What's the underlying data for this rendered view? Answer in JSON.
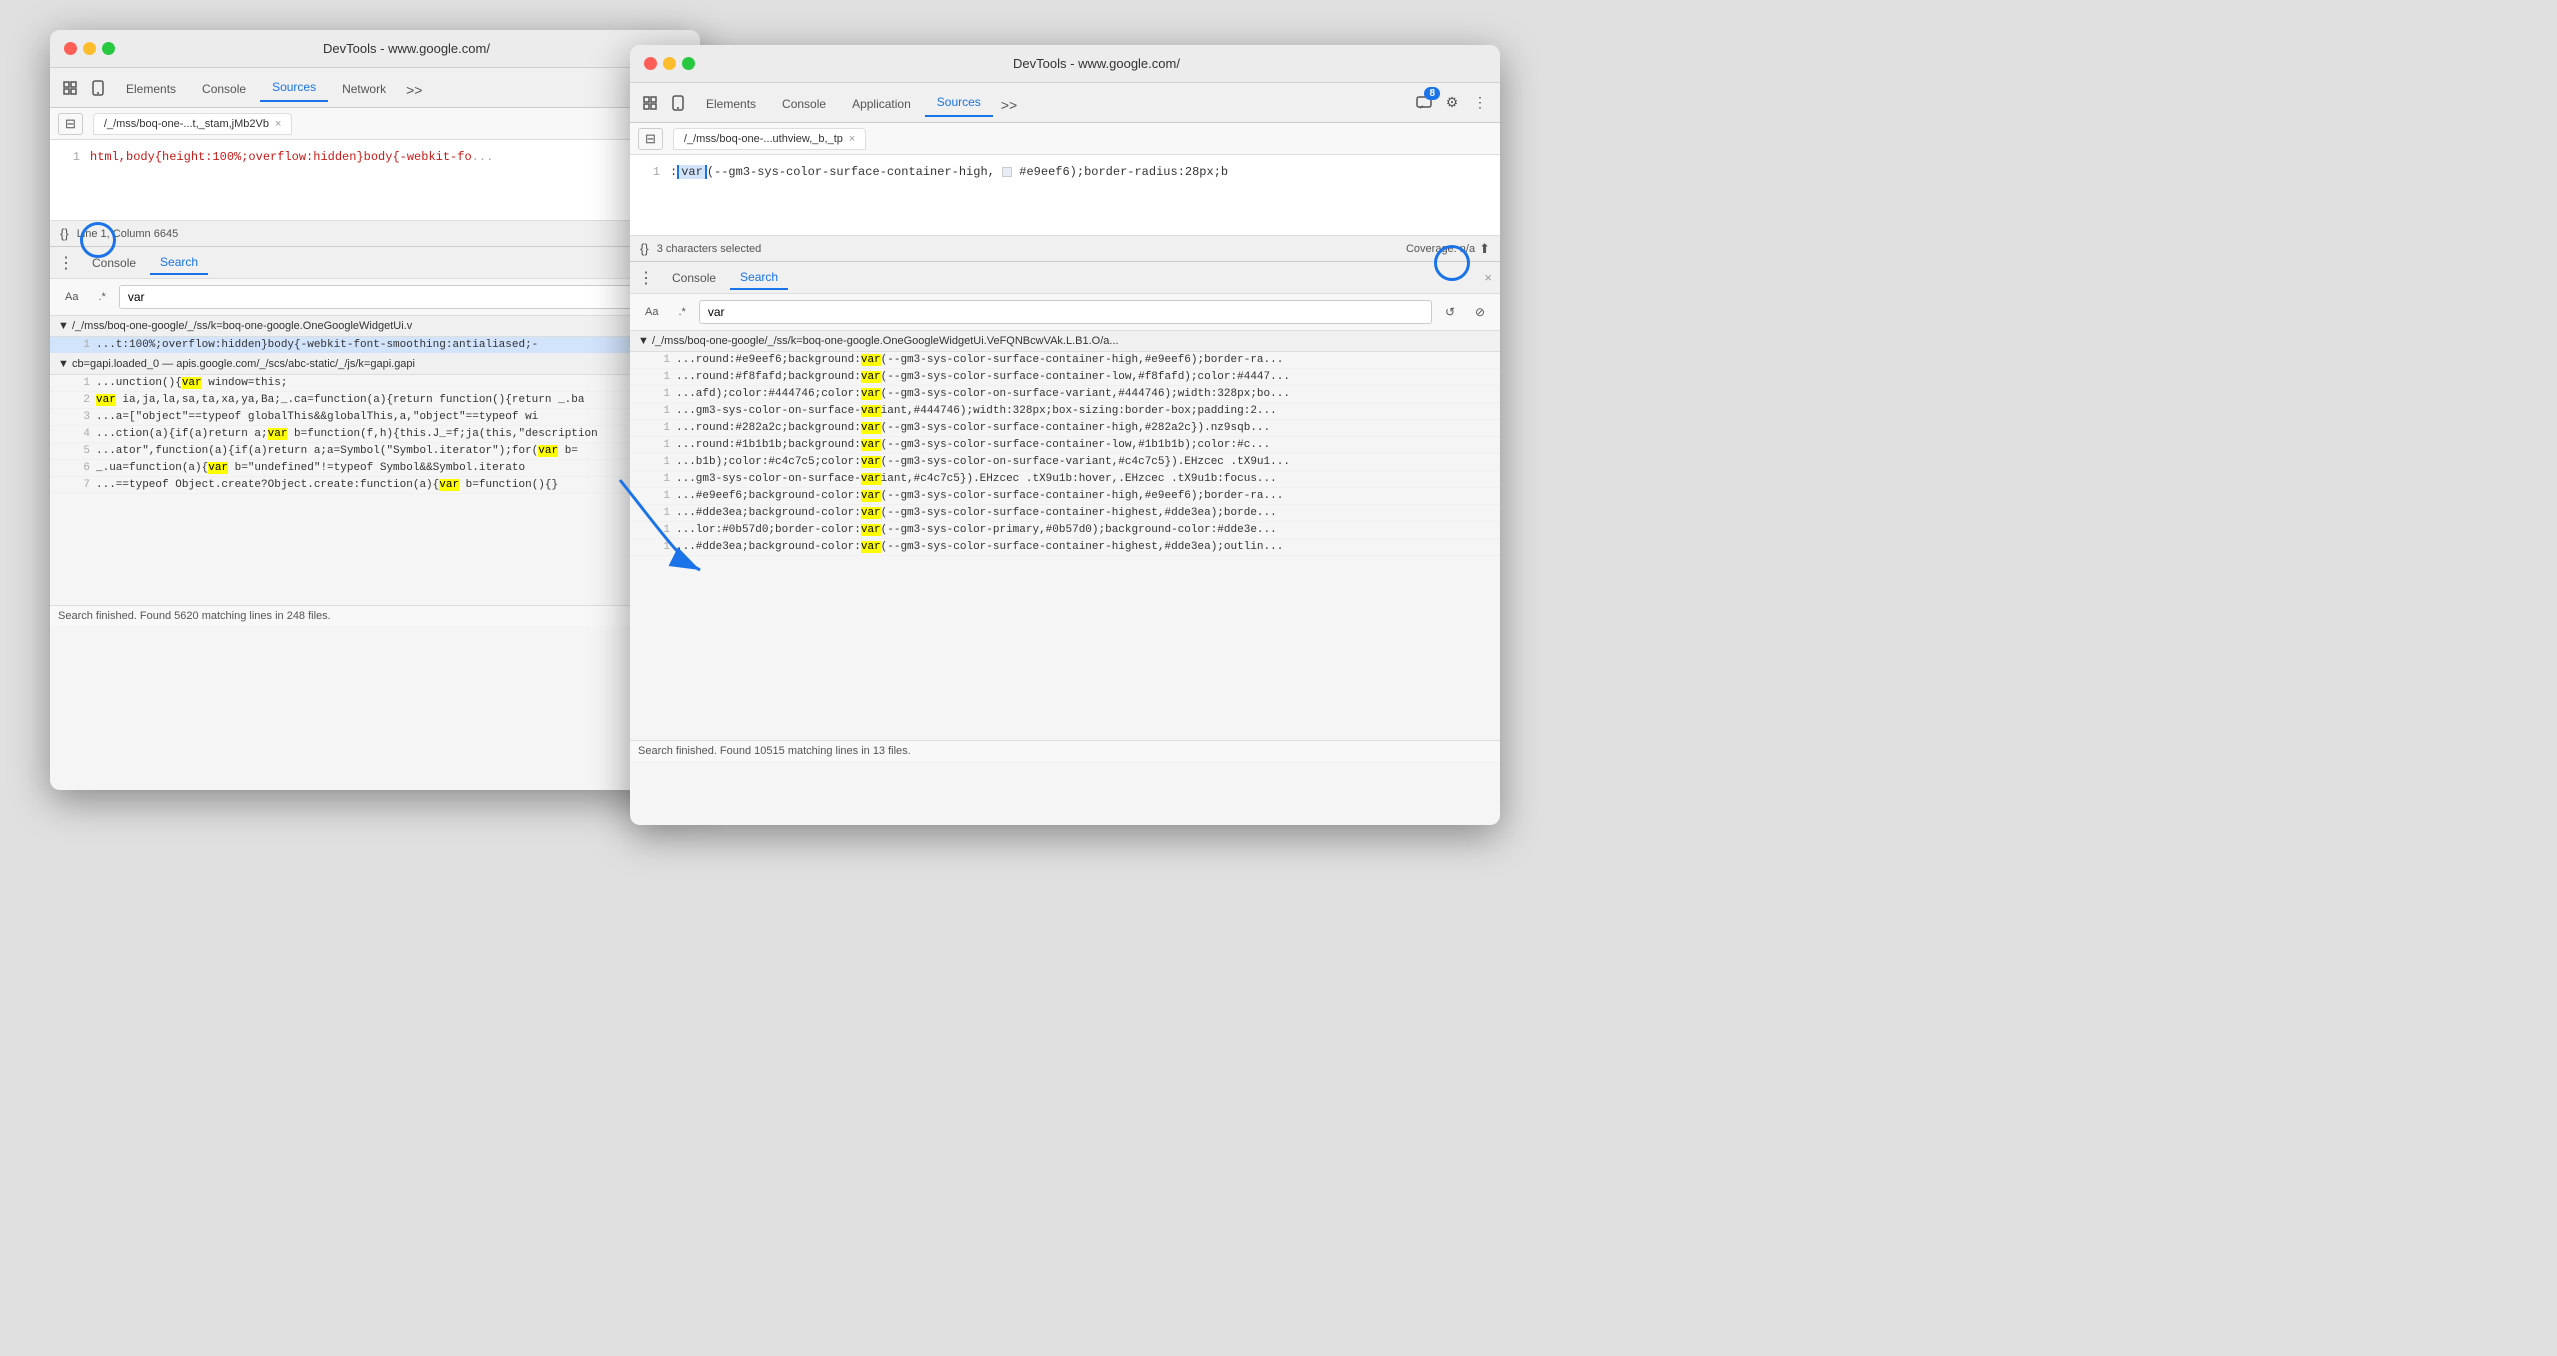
{
  "windows": {
    "left": {
      "title": "DevTools - www.google.com/",
      "tabs": [
        "Elements",
        "Console",
        "Sources",
        "Network",
        ">>"
      ],
      "active_tab": "Sources",
      "file_tab": "/_/mss/boq-one-...t,_stam,jMb2Vb",
      "code": {
        "line1": "html,body{height:100%;overflow:hidden}body{-webkit-fo"
      },
      "status": "Line 1, Column 6645",
      "panel": {
        "tabs": [
          "Console",
          "Search"
        ],
        "active_tab": "Search",
        "search_value": "var",
        "results_header": "▼ /_/mss/boq-one-google/_/ss/k=boq-one-google.OneGoogleWidgetUi.v",
        "results": [
          {
            "num": "1",
            "text": "...t:100%;overflow:hidden}body{-webkit-font-smoothing:antialiased;-",
            "selected": true
          },
          {
            "num": "",
            "text": ""
          }
        ],
        "result_file2": "▼ cb=gapi.loaded_0  —  apis.google.com/_/scs/abc-static/_/js/k=gapi.gapi",
        "results2": [
          {
            "num": "1",
            "text": "...unction(){var window=this;"
          },
          {
            "num": "2",
            "text": "var ia,ja,la,sa,ta,xa,ya,Ba;_.ca=function(a){return function(){return _.ba"
          },
          {
            "num": "3",
            "text": "...a=[\"object\"==typeof globalThis&&globalThis,a,\"object\"==typeof wi"
          },
          {
            "num": "4",
            "text": "...ction(a){if(a)return a;var b=function(f,h){this.J_=f;ja(this,\"description"
          },
          {
            "num": "5",
            "text": "...ator\",function(a){if(a)return a;a=Symbol(\"Symbol.iterator\");for(var b="
          },
          {
            "num": "6",
            "text": "_.ua=function(a){var b=\"undefined\"!=typeof Symbol&&Symbol.iterato"
          },
          {
            "num": "7",
            "text": "...==typeof Object.create?Object.create:function(a){var b=function(){}"
          }
        ],
        "status": "Search finished.  Found 5620 matching lines in 248 files."
      }
    },
    "right": {
      "title": "DevTools - www.google.com/",
      "tabs": [
        "Elements",
        "Console",
        "Application",
        "Sources",
        ">>"
      ],
      "active_tab": "Sources",
      "badge": "8",
      "file_tab": "/_/mss/boq-one-...uthview,_b,_tp",
      "code": {
        "line1": ":var(--gm3-sys-color-surface-container-high, □ #e9eef6);border-radius:28px;b"
      },
      "var_selected": "var",
      "status_left": "3 characters selected",
      "status_right": "Coverage: n/a",
      "panel": {
        "tabs": [
          "Console",
          "Search"
        ],
        "active_tab": "Search",
        "search_value": "var",
        "results_header": "▼ /_/mss/boq-one-google/_/ss/k=boq-one-google.OneGoogleWidgetUi.VeFQNBcwVAk.L.B1.O/a...",
        "results": [
          {
            "num": "1",
            "text": "...round:#e9eef6;background:var(--gm3-sys-color-surface-container-high,#e9eef6);border-ra..."
          },
          {
            "num": "1",
            "text": "...round:#f8fafd;background:var(--gm3-sys-color-surface-container-low,#f8fafd);color:#4447..."
          },
          {
            "num": "1",
            "text": "...afd);color:#444746;color:var(--gm3-sys-color-on-surface-variant,#444746);width:328px;bo..."
          },
          {
            "num": "1",
            "text": "...gm3-sys-color-on-surface-variant,#444746);width:328px;box-sizing:border-box;padding:2..."
          },
          {
            "num": "1",
            "text": "...round:#282a2c;background:var(--gm3-sys-color-surface-container-high,#282a2c}).nz9sqb..."
          },
          {
            "num": "1",
            "text": "...round:#1b1b1b;background:var(--gm3-sys-color-surface-container-low,#1b1b1b);color:#c..."
          },
          {
            "num": "1",
            "text": "...b1b);color:#c4c7c5;color:var(--gm3-sys-color-on-surface-variant,#c4c7c5}).EHzcec .tX9u1..."
          },
          {
            "num": "1",
            "text": "...gm3-sys-color-on-surface-variant,#c4c7c5}).EHzcec .tX9u1b:hover,.EHzcec .tX9u1b:focus..."
          },
          {
            "num": "1",
            "text": "...#e9eef6;background-color:var(--gm3-sys-color-surface-container-high,#e9eef6);border-ra..."
          },
          {
            "num": "1",
            "text": "...#dde3ea;background-color:var(--gm3-sys-color-surface-container-highest,#dde3ea);borde..."
          },
          {
            "num": "1",
            "text": "...lor:#0b57d0;border-color:var(--gm3-sys-color-primary,#0b57d0);background-color:#dde3e..."
          },
          {
            "num": "1",
            "text": "...#dde3ea;background-color:var(--gm3-sys-color-surface-container-highest,#dde3ea);outlin..."
          }
        ],
        "status": "Search finished.  Found 10515 matching lines in 13 files."
      }
    }
  },
  "icons": {
    "cursor": "⌶",
    "device": "📱",
    "more": "»",
    "dots": "⋮",
    "sidebar": "⊞",
    "close": "×",
    "refresh": "↺",
    "clear": "⊘",
    "coverage": "⬆",
    "gear": "⚙",
    "ellipsis": "⋮",
    "chat": "💬"
  }
}
